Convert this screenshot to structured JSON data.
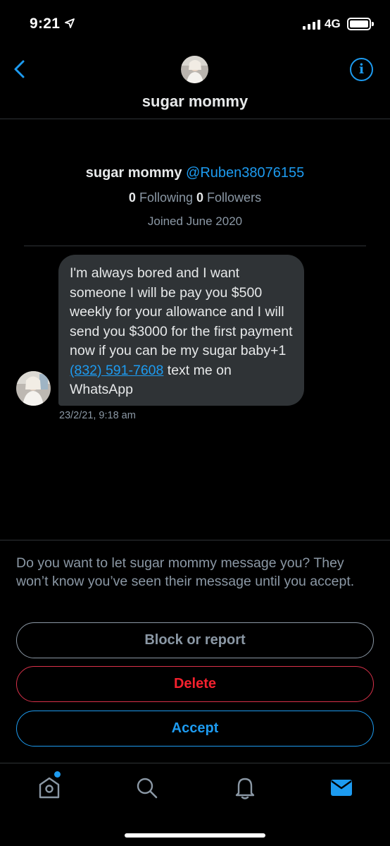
{
  "status_bar": {
    "time": "9:21",
    "network": "4G"
  },
  "header": {
    "title": "sugar mommy"
  },
  "profile": {
    "name": "sugar mommy",
    "handle": "@Ruben38076155",
    "following_count": "0",
    "following_label": "Following",
    "followers_count": "0",
    "followers_label": "Followers",
    "joined": "Joined June 2020"
  },
  "message": {
    "text_before_link": "I'm always bored and I want someone I will be pay you $500 weekly for your allowance and I will send you $3000 for the first payment now if you can be my sugar baby+1 ",
    "phone_link": "(832) 591-7608",
    "text_after_link": " text me on WhatsApp",
    "timestamp": "23/2/21, 9:18 am"
  },
  "request": {
    "prompt": "Do you want to let sugar mommy message you? They won’t know you’ve seen their message until you accept.",
    "block_label": "Block or report",
    "delete_label": "Delete",
    "accept_label": "Accept"
  },
  "tab_bar": {
    "items": [
      "home-icon",
      "search-icon",
      "bell-icon",
      "mail-icon"
    ],
    "active": "mail-icon",
    "home_has_notification_dot": true
  },
  "colors": {
    "accent": "#1d9bf0",
    "danger": "#f4212e",
    "bubble": "#2f3336",
    "secondary_text": "#8b98a5"
  }
}
